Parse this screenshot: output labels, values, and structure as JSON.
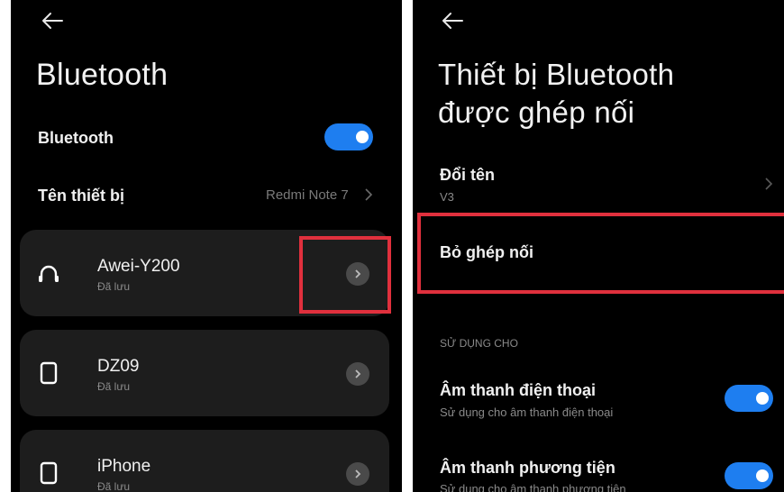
{
  "left": {
    "title": "Bluetooth",
    "bluetooth_label": "Bluetooth",
    "bluetooth_on": true,
    "device_name_label": "Tên thiết bị",
    "device_name_value": "Redmi Note 7",
    "devices": [
      {
        "name": "Awei-Y200",
        "status": "Đã lưu",
        "icon": "headphones-icon"
      },
      {
        "name": "DZ09",
        "status": "Đã lưu",
        "icon": "device-icon"
      },
      {
        "name": "iPhone",
        "status": "Đã lưu",
        "icon": "device-icon"
      }
    ]
  },
  "right": {
    "title_line1": "Thiết bị Bluetooth",
    "title_line2": "được ghép nối",
    "rename_label": "Đổi tên",
    "rename_value": "V3",
    "unpair_label": "Bỏ ghép nối",
    "section_label": "SỬ DỤNG CHO",
    "options": [
      {
        "label": "Âm thanh điện thoại",
        "desc": "Sử dụng cho âm thanh điện thoại",
        "enabled": true
      },
      {
        "label": "Âm thanh phương tiện",
        "desc": "Sử dụng cho âm thanh phương tiện",
        "enabled": true
      }
    ]
  },
  "colors": {
    "accent": "#1e7ef0",
    "highlight": "#e0303d",
    "card": "#1d1d1d",
    "background": "#000000"
  }
}
